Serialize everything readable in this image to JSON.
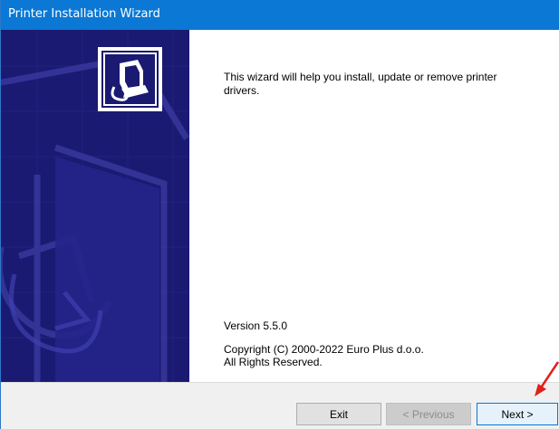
{
  "window": {
    "title": "Printer Installation Wizard"
  },
  "content": {
    "intro": "This wizard will help you install, update or remove printer drivers.",
    "version": "Version 5.5.0",
    "copyright_line1": "Copyright (C) 2000-2022 Euro Plus d.o.o.",
    "copyright_line2": "All Rights Reserved."
  },
  "buttons": {
    "exit": "Exit",
    "previous": "< Previous",
    "next": "Next >"
  },
  "icons": {
    "wizard_logo": "printer-install-icon",
    "annotation": "red-arrow-icon"
  },
  "colors": {
    "titlebar": "#0a78d4",
    "side_panel": "#1a1a72",
    "next_button_border": "#0078d7",
    "annotation_arrow": "#e0201c"
  }
}
